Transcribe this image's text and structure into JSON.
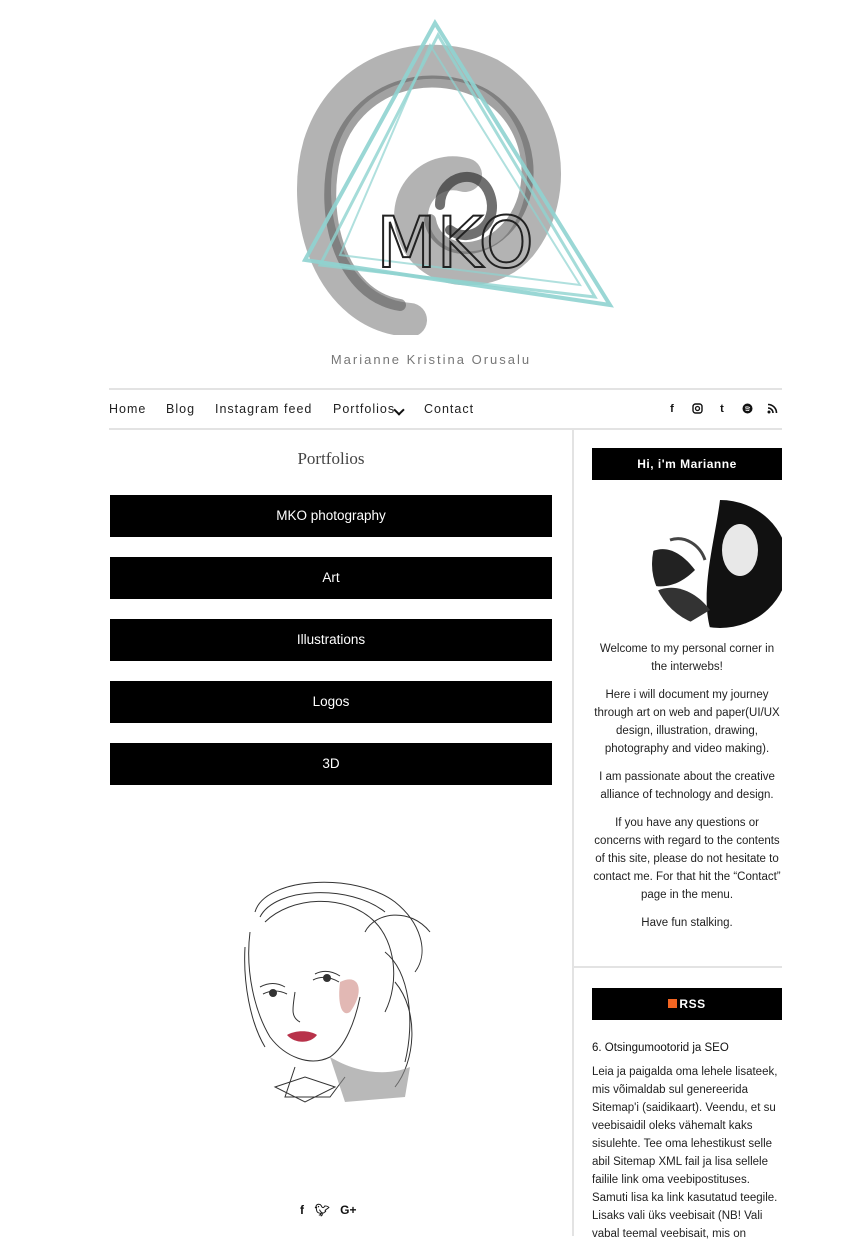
{
  "header": {
    "logo_text": "MKO",
    "tagline": "Marianne Kristina Orusalu"
  },
  "nav": {
    "items": [
      "Home",
      "Blog",
      "Instagram feed",
      "Portfolios",
      "Contact"
    ],
    "social_icons": [
      "facebook-icon",
      "instagram-icon",
      "tumblr-icon",
      "spotify-icon",
      "rss-icon"
    ]
  },
  "main": {
    "title": "Portfolios",
    "buttons": [
      "MKO photography",
      "Art",
      "Illustrations",
      "Logos",
      "3D"
    ],
    "share_icons": [
      "facebook-icon",
      "twitter-icon",
      "google-plus-icon"
    ]
  },
  "sidebar": {
    "about_heading": "Hi, i'm Marianne",
    "about_paragraphs": [
      "Welcome to my personal corner in the interwebs!",
      "Here i will document my journey through art on web and paper(UI/UX design, illustration, drawing, photography and video making).",
      "I am passionate about the creative alliance of technology and design.",
      "If you have any questions or concerns with regard to the contents of this site, please do not hesitate to contact me. For that hit the “Contact” page in the menu.",
      "Have fun stalking."
    ],
    "rss_heading": "RSS",
    "post_title": "6. Otsingumootorid ja SEO",
    "post_excerpt": "Leia ja paigalda oma lehele lisateek, mis võimaldab sul genereerida Sitemap'i (saidikaart). Veendu, et su veebisaidil oleks vähemalt kaks sisulehte. Tee oma lehestikust selle abil Sitemap XML fail ja lisa sellele failile link oma veebipostituses. Samuti lisa ka link kasutatud teegile. Lisaks vali üks veebisait (NB! Vali vabal teemal veebisait, mis on"
  },
  "colors": {
    "accent_teal": "#8fd3d0",
    "button_bg": "#000000",
    "rss_orange": "#f26522"
  }
}
